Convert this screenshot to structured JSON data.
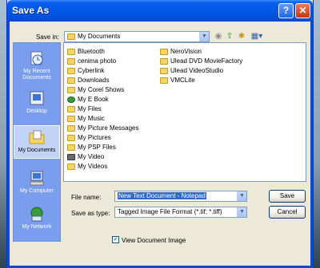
{
  "window": {
    "title": "Save As"
  },
  "title_buttons": {
    "help": "?",
    "close": "✕"
  },
  "toolbar": {
    "save_in_label": "Save in:",
    "save_in_value": "My Documents"
  },
  "places": [
    {
      "label": "My Recent Documents"
    },
    {
      "label": "Desktop"
    },
    {
      "label": "My Documents"
    },
    {
      "label": "My Computer"
    },
    {
      "label": "My Network"
    }
  ],
  "files_col1": [
    "Bluetooth",
    "cenima photo",
    "Cyberlink",
    "Downloads",
    "My Corel Shows",
    "My E Book",
    "My Files",
    "My Music",
    "My Picture Messages",
    "My Pictures",
    "My PSP Files",
    "My Video",
    "My Videos"
  ],
  "files_col2": [
    "NeroVision",
    "Ulead DVD MovieFactory",
    "Ulead VideoStudio",
    "VMCLite"
  ],
  "form": {
    "file_name_label": "File name:",
    "file_name_value": "New Text Document - Notepad",
    "save_as_type_label": "Save as type:",
    "save_as_type_value": "Tagged Image File Format (*.tif; *.tiff)",
    "save_button": "Save",
    "cancel_button": "Cancel",
    "view_document_label": "View Document Image",
    "view_document_checked": true
  },
  "colors": {
    "titlebar": "#0058e6",
    "places_panel": "#7a9eed",
    "selection": "#316ac5",
    "dialog_bg": "#ece9d8"
  }
}
